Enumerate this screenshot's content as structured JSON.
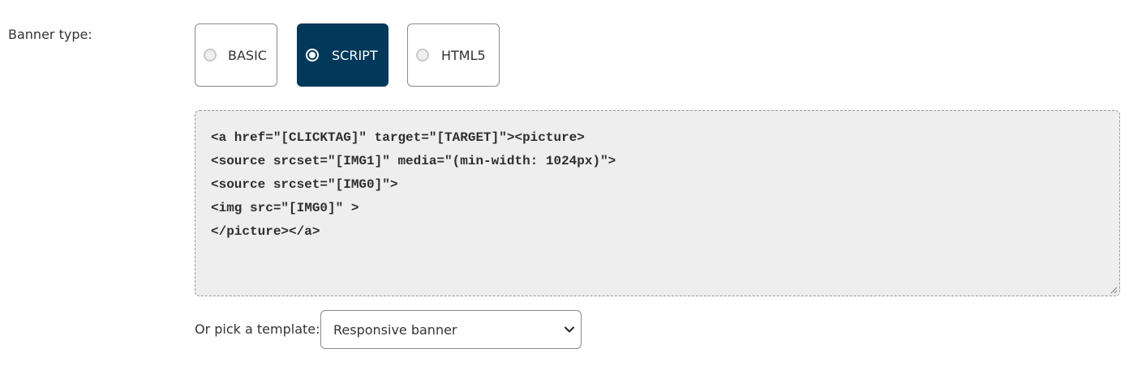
{
  "banner_type": {
    "label": "Banner type:",
    "options": [
      {
        "label": "BASIC",
        "selected": false
      },
      {
        "label": "SCRIPT",
        "selected": true
      },
      {
        "label": "HTML5",
        "selected": false
      }
    ]
  },
  "code_editor": {
    "lines": [
      "<a href=\"[CLICKTAG]\" target=\"[TARGET]\"><picture>",
      "<source srcset=\"[IMG1]\" media=\"(min-width: 1024px)\">",
      "<source srcset=\"[IMG0]\">",
      "<img src=\"[IMG0]\" >",
      "</picture></a>"
    ]
  },
  "template_picker": {
    "label": "Or pick a template:",
    "selected": "Responsive banner",
    "chevron_icon": "chevron-down-icon"
  },
  "colors": {
    "selected_bg": "#02385a",
    "editor_bg": "#eeeeee"
  }
}
